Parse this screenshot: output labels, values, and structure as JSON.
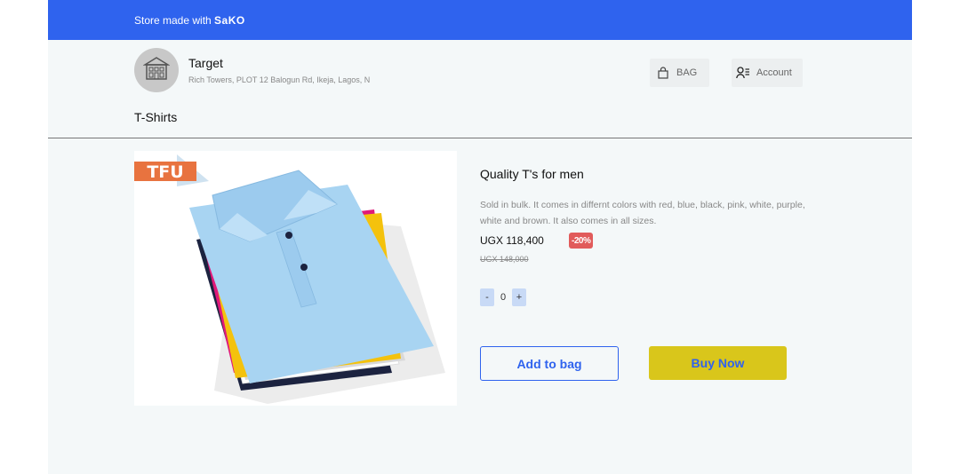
{
  "topbar": {
    "prefix": "Store made with ",
    "brand": "SaKO",
    "color": "#2f63ee"
  },
  "store": {
    "name": "Target",
    "address": "Rich Towers, PLOT 12 Balogun Rd, Ikeja, Lagos, N",
    "logo_icon": "building-icon"
  },
  "header": {
    "bag_label": "BAG",
    "bag_icon": "shopping-bag-icon",
    "account_label": "Account",
    "account_icon": "user-list-icon"
  },
  "category": {
    "title": "T-Shirts"
  },
  "product": {
    "image_badge": "TFU",
    "title": "Quality T's for men",
    "description": "Sold in bulk. It comes in differnt colors with red, blue, black, pink, white, purple, white and brown. It also comes in all sizes.",
    "price": "UGX 118,400",
    "discount": "-20%",
    "old_price": "UGX 148,000",
    "quantity": {
      "minus": "-",
      "value": "0",
      "plus": "+"
    },
    "add_to_bag_label": "Add to bag",
    "buy_now_label": "Buy Now",
    "shirt_colors": [
      "#a8d4f2",
      "#e0197a",
      "#f4c20d",
      "#1c2340",
      "#ffffff",
      "#d9d9d9"
    ]
  }
}
